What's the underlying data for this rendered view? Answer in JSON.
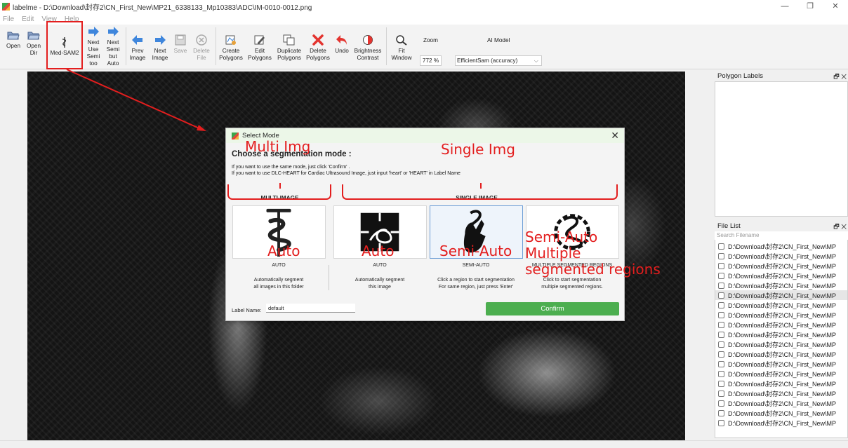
{
  "window": {
    "title": "labelme - D:\\Download\\封存2\\CN_First_New\\MP21_6338133_Mp10383\\ADC\\IM-0010-0012.png",
    "controls": [
      "—",
      "❐",
      "✕"
    ]
  },
  "menu": [
    "File",
    "Edit",
    "View",
    "Help"
  ],
  "toolbar": {
    "open": "Open",
    "open_dir": "Open\nDir",
    "med_sam2": "Med-SAM2",
    "next_use_semi": "Next\nUse\nSemi\ntoo",
    "next_semi_auto": "Next\nSemi\nbut\nAuto",
    "prev_image": "Prev\nImage",
    "next_image": "Next\nImage",
    "save": "Save",
    "delete_file": "Delete\nFile",
    "create_polygons": "Create\nPolygons",
    "edit_polygons": "Edit\nPolygons",
    "duplicate_polygons": "Duplicate\nPolygons",
    "delete_polygons": "Delete\nPolygons",
    "undo": "Undo",
    "brightness_contrast": "Brightness\nContrast",
    "fit_window": "Fit\nWindow",
    "zoom_label": "Zoom",
    "zoom_value": "772 %",
    "ai_model_label": "AI Model",
    "ai_model_value": "EfficientSam (accuracy)"
  },
  "docks": {
    "polygon_labels": "Polygon Labels",
    "file_list": "File List",
    "search_placeholder": "Search Filename",
    "dock_buttons": "🗗 ✕",
    "files": [
      "D:\\Download\\封存2\\CN_First_New\\MP",
      "D:\\Download\\封存2\\CN_First_New\\MP",
      "D:\\Download\\封存2\\CN_First_New\\MP",
      "D:\\Download\\封存2\\CN_First_New\\MP",
      "D:\\Download\\封存2\\CN_First_New\\MP",
      "D:\\Download\\封存2\\CN_First_New\\MP",
      "D:\\Download\\封存2\\CN_First_New\\MP",
      "D:\\Download\\封存2\\CN_First_New\\MP",
      "D:\\Download\\封存2\\CN_First_New\\MP",
      "D:\\Download\\封存2\\CN_First_New\\MP",
      "D:\\Download\\封存2\\CN_First_New\\MP",
      "D:\\Download\\封存2\\CN_First_New\\MP",
      "D:\\Download\\封存2\\CN_First_New\\MP",
      "D:\\Download\\封存2\\CN_First_New\\MP",
      "D:\\Download\\封存2\\CN_First_New\\MP",
      "D:\\Download\\封存2\\CN_First_New\\MP",
      "D:\\Download\\封存2\\CN_First_New\\MP",
      "D:\\Download\\封存2\\CN_First_New\\MP",
      "D:\\Download\\封存2\\CN_First_New\\MP"
    ],
    "selected_index": 5
  },
  "dialog": {
    "title": "Select Mode",
    "heading": "Choose a segmentation mode :",
    "info_line1": "If you want to use the same mode, just click 'Confirm' .",
    "info_line2": "If you want to use DLC-HEART for Cardiac Ultrasound Image, just input 'heart' or 'HEART' in Label Name",
    "multi_group": "MULTI-IMAGE",
    "single_group": "SINGLE IMAGE",
    "cards": [
      {
        "name": "AUTO",
        "desc": "Automatically segment\nall images in this folder"
      },
      {
        "name": "AUTO",
        "desc": "Automatically segment\nthis image"
      },
      {
        "name": "SEMI-AUTO",
        "desc": "Click a region to start segmentation\nFor same region, just press 'Enter'"
      },
      {
        "name": "MULTIPLE SEGMENTED REGIONS",
        "desc": "Click to start segmentation\nmultiple segmented regions."
      }
    ],
    "label_name_label": "Label Name:",
    "label_name_value": "default",
    "confirm": "Confirm"
  },
  "annotations": {
    "multi_img": "Multi Img",
    "single_img": "Single Img",
    "auto1": "Auto",
    "auto2": "Auto",
    "semi_auto": "Semi-Auto",
    "semi_auto_multi": "Semi-Auto\nMultiple\nsegmented regions",
    "color": "#e31e1e"
  }
}
